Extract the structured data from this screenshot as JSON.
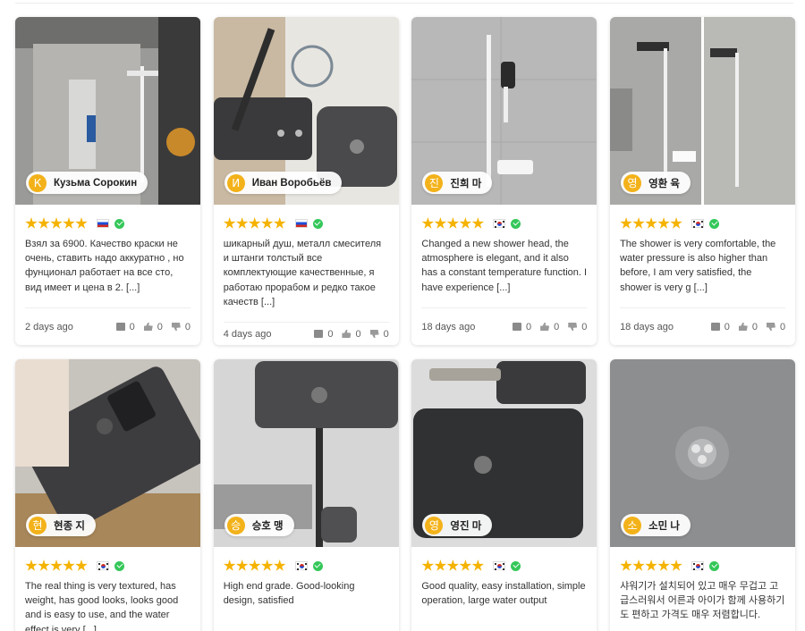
{
  "reviews": [
    {
      "initial": "К",
      "name": "Кузьма Сорокин",
      "stars": 5,
      "country": "ru",
      "text": "Взял за 6900. Качество краски не очень, ставить надо аккуратно , но фунционал работает на все сто, вид имеет и цена в 2. [...]",
      "date": "2 days ago",
      "comments": "0",
      "likes": "0",
      "dislikes": "0"
    },
    {
      "initial": "И",
      "name": "Иван Воробьёв",
      "stars": 5,
      "country": "ru",
      "text": "шикарный душ, металл смесителя и штанги толстый все комплектующие качественные, я работаю прорабом и редко такое качеств [...]",
      "date": "4 days ago",
      "comments": "0",
      "likes": "0",
      "dislikes": "0"
    },
    {
      "initial": "진",
      "name": "진희 마",
      "stars": 5,
      "country": "kr",
      "text": "Changed a new shower head, the atmosphere is elegant, and it also has a constant temperature function. I have experience [...]",
      "date": "18 days ago",
      "comments": "0",
      "likes": "0",
      "dislikes": "0"
    },
    {
      "initial": "영",
      "name": "영환 육",
      "stars": 5,
      "country": "kr",
      "text": "The shower is very comfortable, the water pressure is also higher than before, I am very satisfied, the shower is very g [...]",
      "date": "18 days ago",
      "comments": "0",
      "likes": "0",
      "dislikes": "0"
    },
    {
      "initial": "현",
      "name": "현종 지",
      "stars": 5,
      "country": "kr",
      "text": "The real thing is very textured, has weight, has good looks, looks good and is easy to use, and the water effect is very [...]"
    },
    {
      "initial": "승",
      "name": "승호 맹",
      "stars": 5,
      "country": "kr",
      "text": "High end grade. Good-looking design, satisfied"
    },
    {
      "initial": "영",
      "name": "영진 마",
      "stars": 5,
      "country": "kr",
      "text": "Good quality, easy installation, simple operation, large water output"
    },
    {
      "initial": "소",
      "name": "소민 나",
      "stars": 5,
      "country": "kr",
      "text": "샤워기가 설치되어 있고 매우 무겁고 고급스러워서 어른과 아이가 함께 사용하기도 편하고 가격도 매우 저렴합니다."
    }
  ],
  "colors": {
    "star": "#f5b301",
    "avatar": "#f3b21a",
    "verified": "#34c759"
  }
}
